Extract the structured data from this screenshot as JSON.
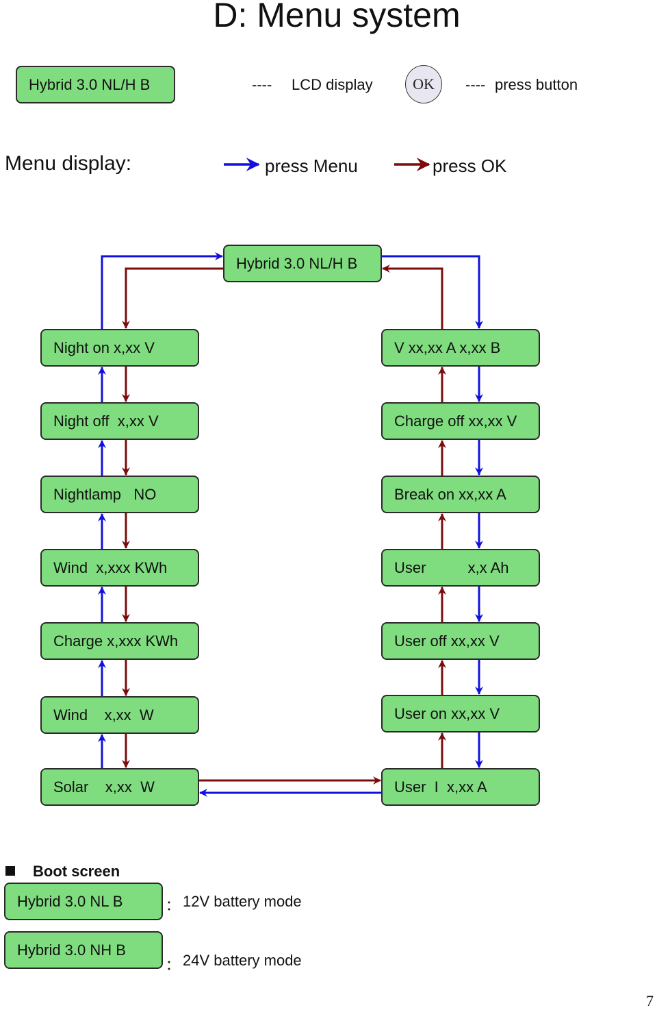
{
  "title": "D: Menu system",
  "legend": {
    "lcd_example": "Hybrid 3.0 NL/H B",
    "lcd_dash": "----",
    "lcd_label": "LCD display",
    "button_label": "OK",
    "button_dash": "----",
    "button_desc": "press button"
  },
  "menu_display": {
    "label": "Menu display:",
    "arrows": [
      {
        "name": "press-menu",
        "label": "press Menu",
        "color": "#1111dd"
      },
      {
        "name": "press-ok",
        "label": "press OK",
        "color": "#7a0c0c"
      }
    ]
  },
  "diagram": {
    "top": "Hybrid 3.0 NL/H B",
    "left_column": [
      "Night on x,xx V",
      "Night off  x,xx V",
      "Nightlamp   NO",
      "Wind  x,xxx KWh",
      "Charge x,xxx KWh",
      "Wind    x,xx  W",
      "Solar    x,xx  W"
    ],
    "right_column": [
      "V xx,xx A x,xx B",
      "Charge off xx,xx V",
      "Break on xx,xx A",
      "User          x,x Ah",
      "User off xx,xx V",
      "User on xx,xx V",
      "User  I  x,xx A"
    ],
    "colors": {
      "box_fill": "#7fdd7f",
      "box_border": "#2a2a2a",
      "menu_arrow": "#1111dd",
      "ok_arrow": "#7a0c0c"
    }
  },
  "boot_screen": {
    "heading": "Boot screen",
    "items": [
      {
        "display": "Hybrid 3.0 NL B",
        "colon": "：",
        "description": "12V battery mode"
      },
      {
        "display": "Hybrid 3.0 NH B",
        "colon": "：",
        "description": "24V battery mode"
      }
    ]
  },
  "page_number": "7"
}
